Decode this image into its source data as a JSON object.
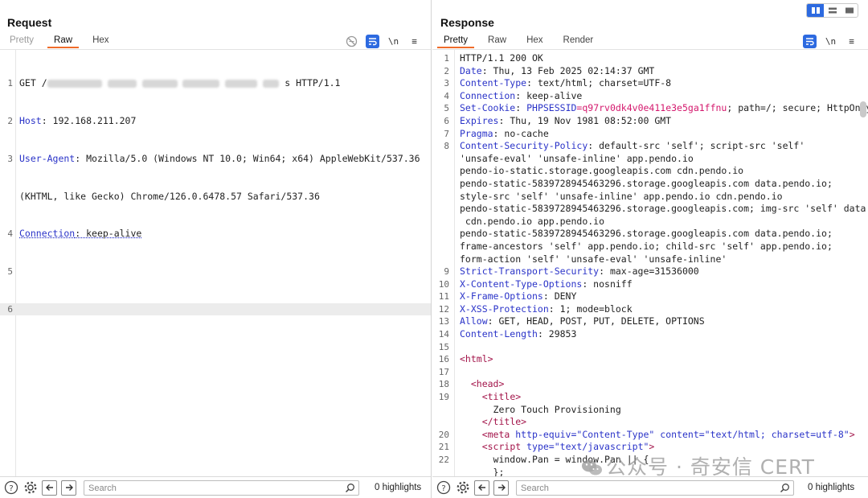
{
  "request": {
    "title": "Request",
    "tabs": [
      "Pretty",
      "Raw",
      "Hex"
    ],
    "active_tab": "Raw",
    "tools": {
      "wrap": "\\n",
      "menu": "≡"
    },
    "lines": [
      {
        "n": "1",
        "pre": "GET /",
        "post": "s HTTP/1.1"
      },
      {
        "n": "2",
        "key": "Host",
        "val": ": 192.168.211.207"
      },
      {
        "n": "3",
        "key": "User-Agent",
        "val": ": Mozilla/5.0 (Windows NT 10.0; Win64; x64) AppleWebKit/537.36"
      },
      {
        "n": "",
        "val": "(KHTML, like Gecko) Chrome/126.0.6478.57 Safari/537.36"
      },
      {
        "n": "4",
        "key": "Connection",
        "val": ": keep-alive"
      },
      {
        "n": "5",
        "val": ""
      },
      {
        "n": "6",
        "val": ""
      }
    ],
    "search_placeholder": "Search",
    "highlights": "0 highlights"
  },
  "response": {
    "title": "Response",
    "tabs": [
      "Pretty",
      "Raw",
      "Hex",
      "Render"
    ],
    "active_tab": "Pretty",
    "tools": {
      "wrap": "\\n",
      "menu": "≡"
    },
    "lines": [
      {
        "n": "1",
        "status": "HTTP/1.1 200 OK"
      },
      {
        "n": "2",
        "key": "Date",
        "val": ": Thu, 13 Feb 2025 02:14:37 GMT"
      },
      {
        "n": "3",
        "key": "Content-Type",
        "val": ": text/html; charset=UTF-8"
      },
      {
        "n": "4",
        "key": "Connection",
        "val": ": keep-alive"
      },
      {
        "n": "5",
        "key": "Set-Cookie",
        "val": ": ",
        "cookie_key": "PHPSESSID",
        "cookie_val": "=q97rv0dk4v0e411e3e5ga1ffnu",
        "rest": "; path=/; secure; HttpOnly"
      },
      {
        "n": "6",
        "key": "Expires",
        "val": ": Thu, 19 Nov 1981 08:52:00 GMT"
      },
      {
        "n": "7",
        "key": "Pragma",
        "val": ": no-cache"
      },
      {
        "n": "8",
        "key": "Content-Security-Policy",
        "val": ": default-src 'self'; script-src 'self'"
      },
      {
        "n": "",
        "val": "'unsafe-eval' 'unsafe-inline' app.pendo.io"
      },
      {
        "n": "",
        "val": "pendo-io-static.storage.googleapis.com cdn.pendo.io"
      },
      {
        "n": "",
        "val": "pendo-static-5839728945463296.storage.googleapis.com data.pendo.io;"
      },
      {
        "n": "",
        "val": "style-src 'self' 'unsafe-inline' app.pendo.io cdn.pendo.io"
      },
      {
        "n": "",
        "val": "pendo-static-5839728945463296.storage.googleapis.com; img-src 'self' data:"
      },
      {
        "n": "",
        "val": " cdn.pendo.io app.pendo.io"
      },
      {
        "n": "",
        "val": "pendo-static-5839728945463296.storage.googleapis.com data.pendo.io;"
      },
      {
        "n": "",
        "val": "frame-ancestors 'self' app.pendo.io; child-src 'self' app.pendo.io;"
      },
      {
        "n": "",
        "val": "form-action 'self' 'unsafe-eval' 'unsafe-inline'"
      },
      {
        "n": "9",
        "key": "Strict-Transport-Security",
        "val": ": max-age=31536000"
      },
      {
        "n": "10",
        "key": "X-Content-Type-Options",
        "val": ": nosniff"
      },
      {
        "n": "11",
        "key": "X-Frame-Options",
        "val": ": DENY"
      },
      {
        "n": "12",
        "key": "X-XSS-Protection",
        "val": ": 1; mode=block"
      },
      {
        "n": "13",
        "key": "Allow",
        "val": ": GET, HEAD, POST, PUT, DELETE, OPTIONS"
      },
      {
        "n": "14",
        "key": "Content-Length",
        "val": ": 29853"
      },
      {
        "n": "15",
        "val": ""
      },
      {
        "n": "16",
        "tag": "<html>",
        "indent": ""
      },
      {
        "n": "17",
        "val": ""
      },
      {
        "n": "18",
        "tag": "<head>",
        "indent": "  "
      },
      {
        "n": "19",
        "tag": "<title>",
        "indent": "    "
      },
      {
        "n": "",
        "val": "      Zero Touch Provisioning"
      },
      {
        "n": "",
        "tag": "</title>",
        "indent": "    "
      },
      {
        "n": "20",
        "meta": true
      },
      {
        "n": "21",
        "script": true
      },
      {
        "n": "22",
        "val": "      window.Pan = window.Pan || {"
      },
      {
        "n": "",
        "val": "      };"
      }
    ],
    "meta_line": {
      "indent": "    ",
      "open": "<meta ",
      "a1": "http-equiv",
      "v1": "=\"Content-Type\"",
      "a2": " content",
      "v2": "=\"text/html; charset=utf-8\"",
      "close": ">"
    },
    "script_line": {
      "indent": "    ",
      "open": "<script ",
      "a1": "type",
      "v1": "=\"text/javascript\"",
      "close": ">"
    },
    "search_placeholder": "Search",
    "highlights": "0 highlights"
  },
  "watermark": "公众号 · 奇安信 CERT",
  "colors": {
    "accent": "#2d6ae0",
    "tab_underline": "#f06c2b",
    "header_key": "#2a33c8",
    "tag": "#a3154a"
  }
}
